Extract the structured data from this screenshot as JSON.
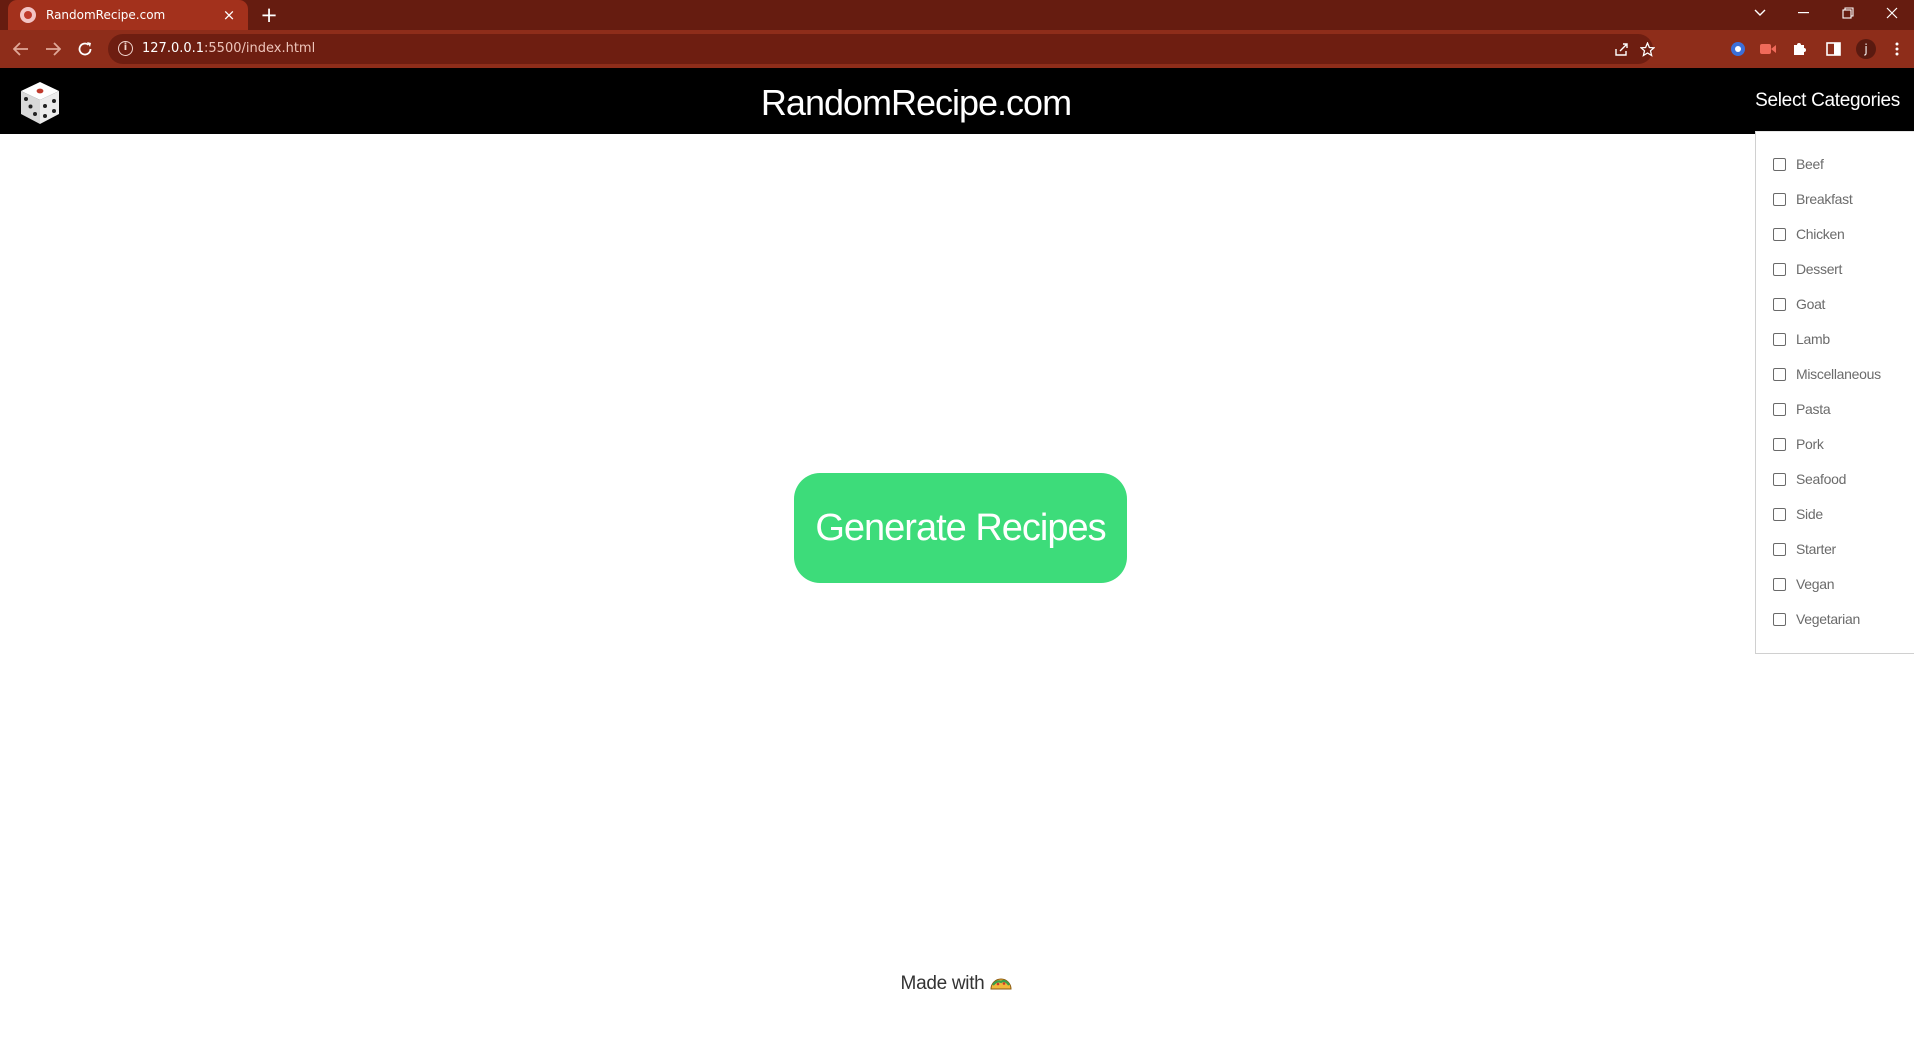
{
  "browser": {
    "tab_title": "RandomRecipe.com",
    "tab_close": "×",
    "new_tab": "+",
    "url_host": "127.0.0.1",
    "url_path": ":5500/index.html",
    "info_glyph": "i",
    "profile_initial": "j",
    "icons": [
      "back-arrow-icon",
      "forward-arrow-icon",
      "reload-icon",
      "share-icon",
      "star-icon",
      "extension-puzzle-icon",
      "side-panel-icon",
      "menu-kebab-icon"
    ]
  },
  "header": {
    "site_title": "RandomRecipe.com",
    "select_categories": "Select Categories"
  },
  "categories": [
    {
      "label": "Beef",
      "checked": false
    },
    {
      "label": "Breakfast",
      "checked": false
    },
    {
      "label": "Chicken",
      "checked": false
    },
    {
      "label": "Dessert",
      "checked": false
    },
    {
      "label": "Goat",
      "checked": false
    },
    {
      "label": "Lamb",
      "checked": false
    },
    {
      "label": "Miscellaneous",
      "checked": false
    },
    {
      "label": "Pasta",
      "checked": false
    },
    {
      "label": "Pork",
      "checked": false
    },
    {
      "label": "Seafood",
      "checked": false
    },
    {
      "label": "Side",
      "checked": false
    },
    {
      "label": "Starter",
      "checked": false
    },
    {
      "label": "Vegan",
      "checked": false
    },
    {
      "label": "Vegetarian",
      "checked": false
    }
  ],
  "main": {
    "generate_label": "Generate Recipes"
  },
  "footer": {
    "made_with": "Made with"
  },
  "colors": {
    "tabstrip": "#661c10",
    "toolbar": "#8e2d1a",
    "header_bg": "#000000",
    "button_green": "#3ddc7a"
  }
}
